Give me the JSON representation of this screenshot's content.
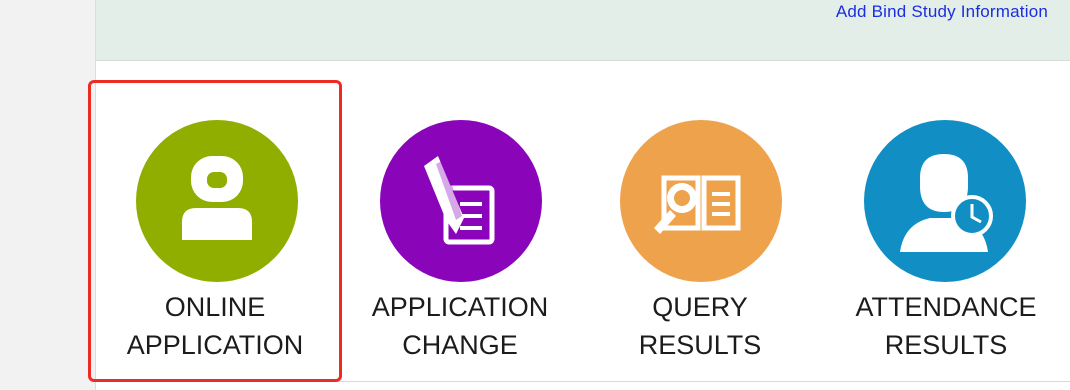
{
  "header": {
    "link_label": "Add Bind Study Information"
  },
  "tiles": [
    {
      "line1": "ONLINE",
      "line2": "APPLICATION",
      "icon": "person-icon",
      "color": "#8fae00",
      "selected": true
    },
    {
      "line1": "APPLICATION",
      "line2": "CHANGE",
      "icon": "pen-document-icon",
      "color": "#8a05b9",
      "selected": false
    },
    {
      "line1": "QUERY",
      "line2": "RESULTS",
      "icon": "magnifier-book-icon",
      "color": "#eea24c",
      "selected": false
    },
    {
      "line1": "ATTENDANCE",
      "line2": "RESULTS",
      "icon": "person-clock-icon",
      "color": "#118ec4",
      "selected": false
    }
  ]
}
